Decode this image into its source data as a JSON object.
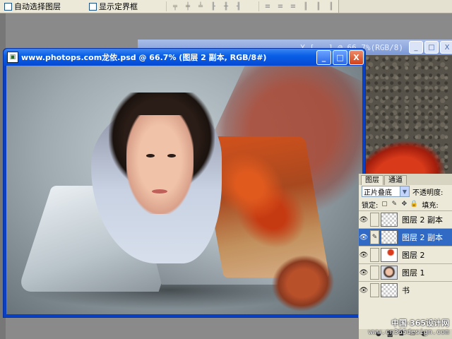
{
  "options_bar": {
    "auto_select_layer": "自动选择图层",
    "show_bounding_box": "显示定界框"
  },
  "back_window": {
    "title": "...Y [...] @ 66.7%(RGB/8)"
  },
  "document_window": {
    "title": "www.photops.com龙依.psd @ 66.7% (图层 2 副本, RGB/8#)",
    "minimize": "_",
    "maximize": "□",
    "close": "X"
  },
  "layers_panel": {
    "tabs": [
      "图层",
      "通道"
    ],
    "blend_mode": "正片叠底",
    "opacity_label": "不透明度:",
    "lock_label": "锁定:",
    "fill_label": "填充:",
    "layers": [
      {
        "name": "图层 2 副本",
        "selected": false,
        "thumb": "checker"
      },
      {
        "name": "图层 2 副本",
        "selected": true,
        "thumb": "checker"
      },
      {
        "name": "图层 2",
        "selected": false,
        "thumb": "red"
      },
      {
        "name": "图层 1",
        "selected": false,
        "thumb": "face"
      },
      {
        "name": "书",
        "selected": false,
        "thumb": "checker"
      }
    ]
  },
  "watermark": {
    "line1": "中国·365设计网",
    "line2": "www.cn365design.com"
  },
  "colors": {
    "title_blue": "#0a5fe6",
    "selected_layer": "#316ac5",
    "panel_bg": "#ece9d8"
  }
}
